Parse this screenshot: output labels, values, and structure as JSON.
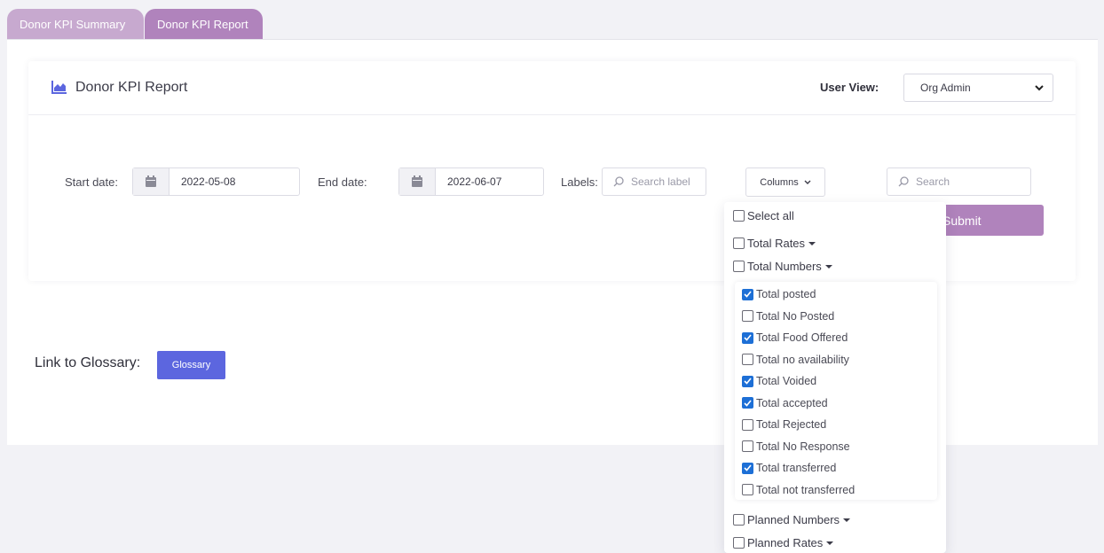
{
  "tabs": [
    {
      "label": "Donor KPI Summary",
      "active": false
    },
    {
      "label": "Donor KPI Report",
      "active": true
    }
  ],
  "header": {
    "title": "Donor KPI Report",
    "title_icon": "area-chart-icon",
    "user_view_label": "User View:",
    "user_view_value": "Org Admin"
  },
  "filters": {
    "start_date_label": "Start date:",
    "start_date_value": "2022-05-08",
    "end_date_label": "End date:",
    "end_date_value": "2022-06-07",
    "labels_label": "Labels:",
    "labels_placeholder": "Search label",
    "columns_label": "Columns",
    "search_placeholder": "Search",
    "submit_label": "Submit"
  },
  "glossary": {
    "label": "Link to Glossary:",
    "button_label": "Glossary"
  },
  "columns_dropdown": {
    "select_all": {
      "label": "Select all",
      "checked": false
    },
    "groups": [
      {
        "label": "Total Rates",
        "checked": false
      },
      {
        "label": "Total Numbers",
        "checked": false
      },
      {
        "label": "Planned Numbers",
        "checked": false
      },
      {
        "label": "Planned Rates",
        "checked": false
      }
    ],
    "total_numbers_items": [
      {
        "label": "Total posted",
        "checked": true
      },
      {
        "label": "Total No Posted",
        "checked": false
      },
      {
        "label": "Total Food Offered",
        "checked": true
      },
      {
        "label": "Total no availability",
        "checked": false
      },
      {
        "label": "Total Voided",
        "checked": true
      },
      {
        "label": "Total accepted",
        "checked": true
      },
      {
        "label": "Total Rejected",
        "checked": false
      },
      {
        "label": "Total No Response",
        "checked": false
      },
      {
        "label": "Total transferred",
        "checked": true
      },
      {
        "label": "Total not transferred",
        "checked": false
      }
    ]
  },
  "colors": {
    "tab_active": "#b083bc",
    "tab_inactive": "#c7a9cf",
    "submit": "#b083bc",
    "glossary_button": "#5c66df",
    "accent_icon": "#5c66df",
    "checkbox_checked": "#1d6fd6"
  }
}
